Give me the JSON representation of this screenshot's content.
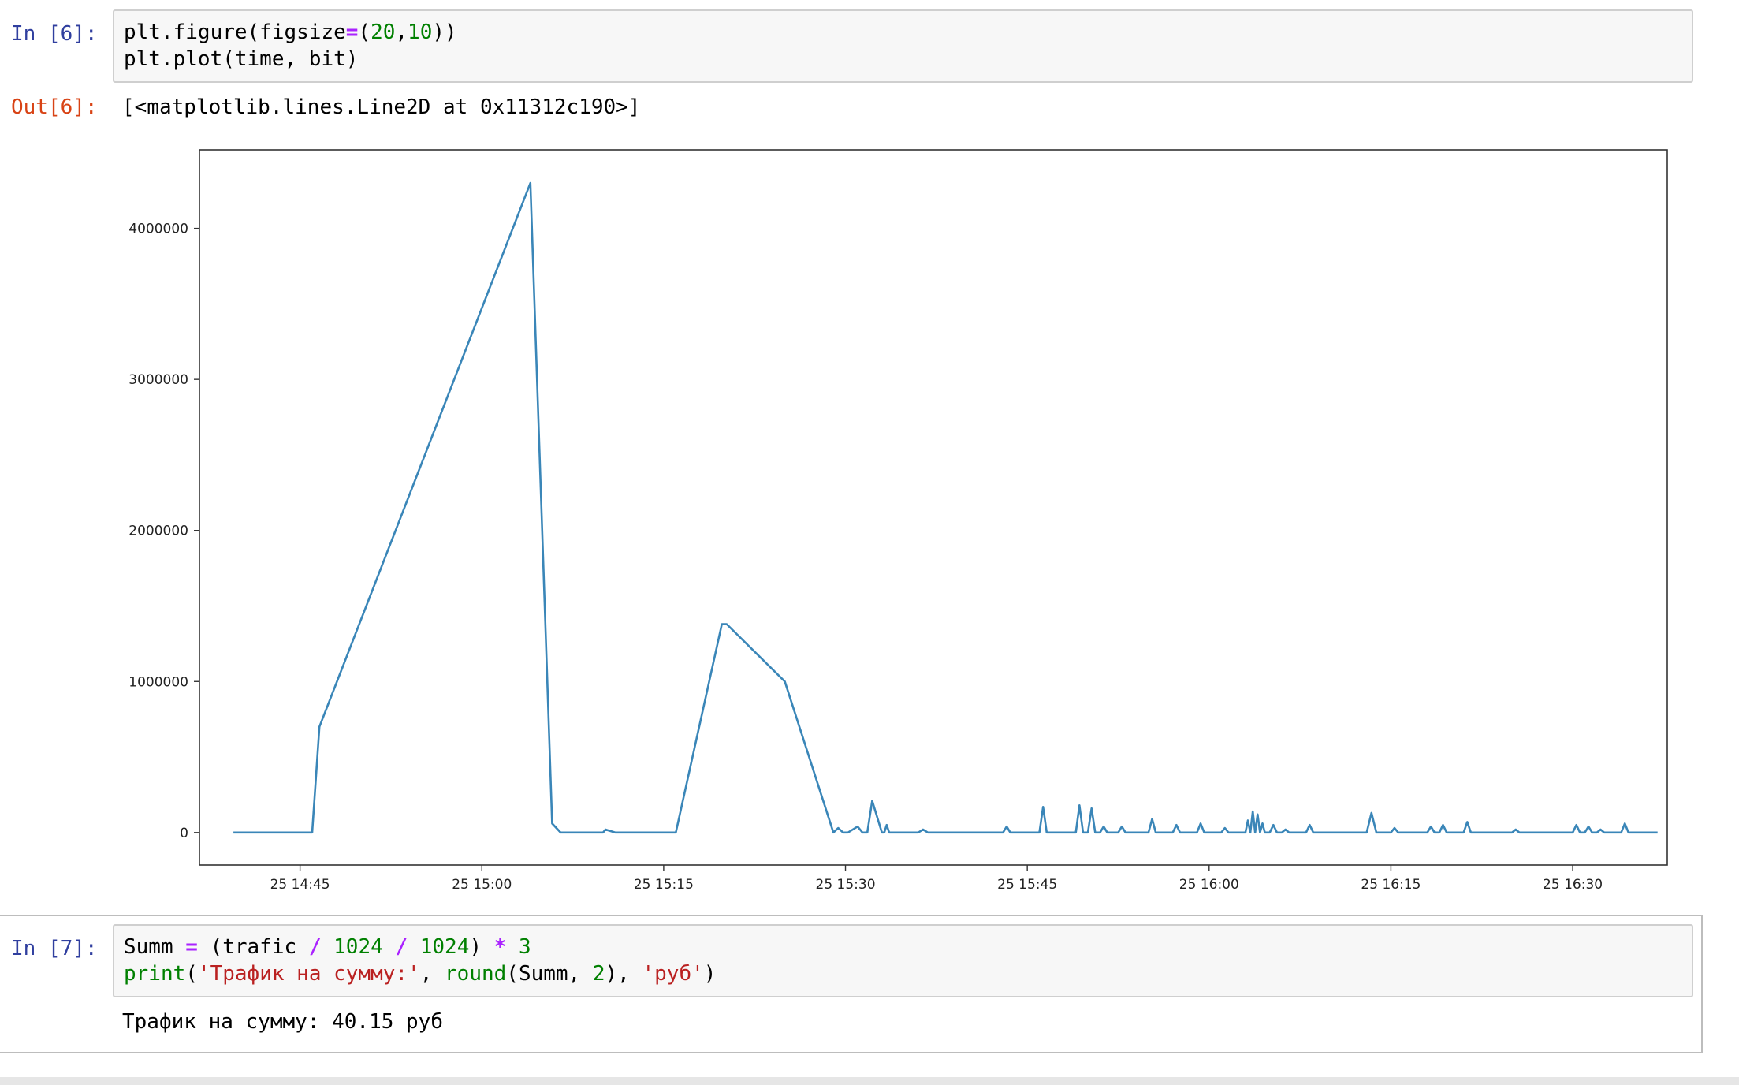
{
  "cells": {
    "in6": {
      "prompt": "In [6]:",
      "line1": [
        "plt.figure(figsize",
        "=",
        "(",
        "20",
        ",",
        "10",
        "))"
      ],
      "line2": "plt.plot(time, bit)"
    },
    "out6": {
      "prompt": "Out[6]:",
      "text": "[<matplotlib.lines.Line2D at 0x11312c190>]"
    },
    "in7": {
      "prompt": "In [7]:",
      "line1": [
        "Summ ",
        "=",
        " (trafic ",
        "/",
        " ",
        "1024",
        " ",
        "/",
        " ",
        "1024",
        ") ",
        "*",
        " ",
        "3"
      ],
      "line2": [
        "print",
        "(",
        "'Трафик на сумму:'",
        ", ",
        "round",
        "(Summ, ",
        "2",
        "), ",
        "'руб'",
        ")"
      ],
      "output": "Трафик на сумму: 40.15 руб"
    }
  },
  "colors": {
    "line": "#3a86b8",
    "prompt_in": "#303f9f",
    "prompt_out": "#d84315"
  },
  "chart_data": {
    "type": "line",
    "title": "",
    "xlabel": "",
    "ylabel": "",
    "x_tick_labels": [
      "25 14:45",
      "25 15:00",
      "25 15:15",
      "25 15:30",
      "25 15:45",
      "25 16:00",
      "25 16:15",
      "25 16:30"
    ],
    "y_tick_labels": [
      "0",
      "1000000",
      "2000000",
      "3000000",
      "4000000"
    ],
    "y_ticks": [
      0,
      1000000,
      2000000,
      3000000,
      4000000
    ],
    "ylim": [
      -215000,
      4520000
    ],
    "xlim_minutes_from_1445": [
      -8.3,
      112.8
    ],
    "x_axis_origin": "25 14:45",
    "x_unit": "minutes",
    "grid": false,
    "series": [
      {
        "x_minutes": [
          -5.5,
          1.0,
          1.6,
          19.0,
          20.8,
          21.5,
          25.0,
          25.2,
          26.0,
          31.0,
          34.8,
          35.0,
          35.2,
          40.0,
          44.0,
          44.4,
          44.8,
          45.2,
          46.0,
          46.4,
          46.8,
          47.2,
          48.0,
          48.2,
          48.4,
          48.6,
          49.0,
          49.4,
          51.0,
          51.4,
          51.8,
          52.0,
          52.2,
          55.0,
          58.0,
          58.3,
          58.6,
          61.0,
          61.3,
          61.6,
          64.0,
          64.3,
          64.6,
          65.0,
          65.3,
          65.6,
          66.0,
          66.3,
          66.6,
          67.5,
          67.8,
          68.1,
          70.0,
          70.3,
          70.6,
          72.0,
          72.3,
          72.6,
          74.0,
          74.3,
          74.6,
          76.0,
          76.3,
          76.6,
          78.0,
          78.2,
          78.4,
          78.6,
          78.8,
          79.0,
          79.2,
          79.4,
          79.6,
          80.0,
          80.3,
          80.6,
          81.0,
          81.3,
          81.6,
          83.0,
          83.3,
          83.6,
          88.0,
          88.4,
          88.8,
          89.2,
          90.0,
          90.3,
          90.6,
          92.0,
          93.0,
          93.3,
          93.6,
          94.0,
          94.3,
          94.6,
          96.0,
          96.3,
          96.6,
          100.0,
          100.3,
          100.6,
          105.0,
          105.3,
          105.6,
          106.0,
          106.3,
          106.6,
          107.0,
          107.3,
          107.6,
          109.0,
          109.3,
          109.6,
          110.0,
          112.0
        ],
        "y": [
          0,
          0,
          700000,
          4300000,
          60000,
          0,
          0,
          20000,
          0,
          0,
          1380000,
          1380000,
          1380000,
          1000000,
          0,
          30000,
          0,
          0,
          40000,
          0,
          0,
          210000,
          0,
          0,
          50000,
          0,
          0,
          0,
          0,
          20000,
          0,
          0,
          0,
          0,
          0,
          40000,
          0,
          0,
          170000,
          0,
          0,
          180000,
          0,
          0,
          160000,
          0,
          0,
          40000,
          0,
          0,
          40000,
          0,
          0,
          90000,
          0,
          0,
          50000,
          0,
          0,
          60000,
          0,
          0,
          30000,
          0,
          0,
          80000,
          0,
          140000,
          0,
          120000,
          0,
          60000,
          0,
          0,
          50000,
          0,
          0,
          20000,
          0,
          0,
          50000,
          0,
          0,
          130000,
          0,
          0,
          0,
          30000,
          0,
          0,
          0,
          40000,
          0,
          0,
          50000,
          0,
          0,
          70000,
          0,
          0,
          20000,
          0,
          0,
          50000,
          0,
          0,
          40000,
          0,
          0,
          20000,
          0,
          0,
          60000,
          0,
          0,
          0
        ]
      }
    ]
  }
}
